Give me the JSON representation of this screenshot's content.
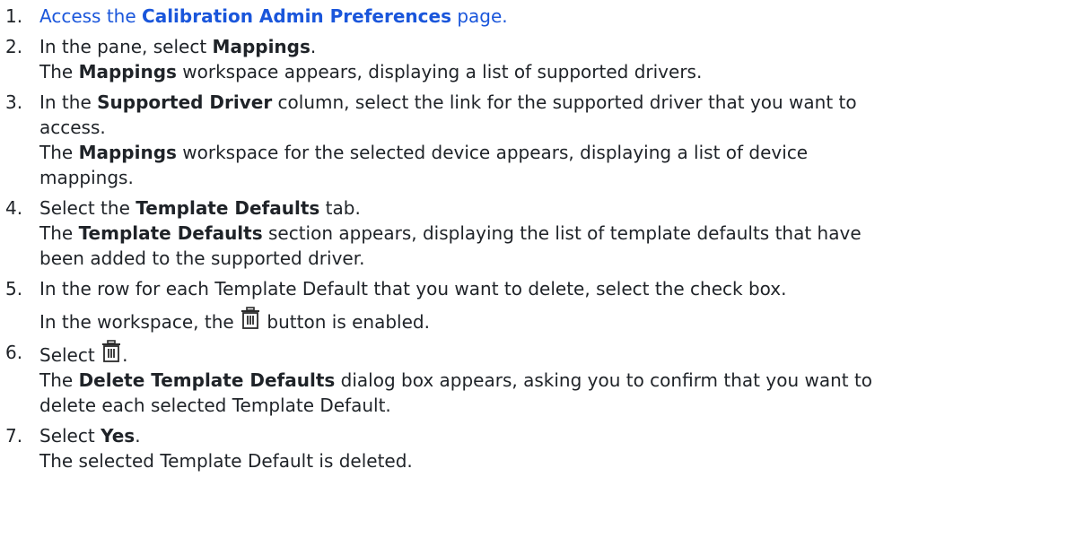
{
  "steps": [
    {
      "num": "1.",
      "link_prefix": "Access the ",
      "link_bold": "Calibration Admin Preferences",
      "link_suffix": " page."
    },
    {
      "num": "2.",
      "a1": "In the pane, select ",
      "b1": "Mappings",
      "a2": ".",
      "r1": "The ",
      "rb1": "Mappings",
      "r2": " workspace appears, displaying a list of supported drivers."
    },
    {
      "num": "3.",
      "a1": "In the ",
      "b1": "Supported Driver",
      "a2": " column, select the link for the supported driver that you want to",
      "a3": "access.",
      "r1": "The ",
      "rb1": "Mappings",
      "r2": " workspace for the selected device appears, displaying a list of device",
      "r3": "mappings."
    },
    {
      "num": "4.",
      "a1": "Select the ",
      "b1": "Template Defaults",
      "a2": " tab.",
      "r1": "The ",
      "rb1": "Template Defaults",
      "r2": " section appears, displaying the list of template defaults that have",
      "r3": "been added to the supported driver."
    },
    {
      "num": "5.",
      "a1": "In the row for each Template Default that you want to delete, select the check box.",
      "r1": "In the workspace, the ",
      "r2": " button is enabled."
    },
    {
      "num": "6.",
      "a1": "Select ",
      "a2": ".",
      "r1": "The ",
      "rb1": "Delete Template Defaults",
      "r2": " dialog box appears, asking you to confirm that you want to",
      "r3": "delete each selected Template Default."
    },
    {
      "num": "7.",
      "a1": "Select ",
      "b1": "Yes",
      "a2": ".",
      "r1": "The selected Template Default is deleted."
    }
  ],
  "icons": {
    "delete": "trash-icon"
  },
  "colors": {
    "link": "#1a56db",
    "text": "#1f2328"
  }
}
